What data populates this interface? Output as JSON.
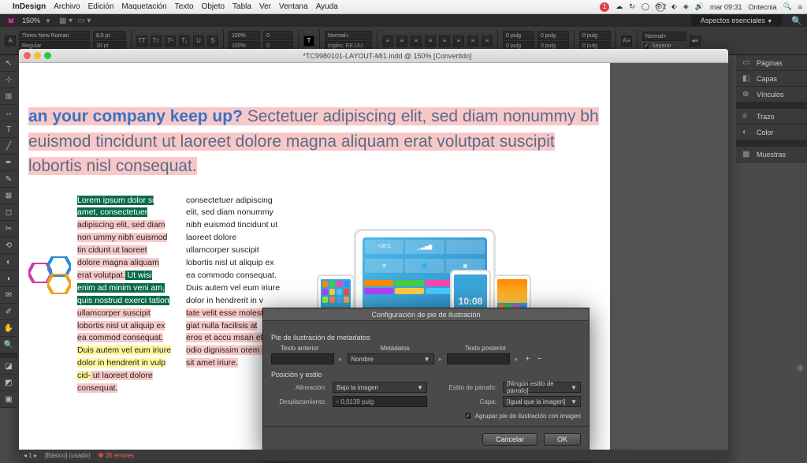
{
  "menubar": {
    "app_name": "InDesign",
    "items": [
      "Archivo",
      "Edición",
      "Maquetación",
      "Texto",
      "Objeto",
      "Tabla",
      "Ver",
      "Ventana",
      "Ayuda"
    ],
    "status": {
      "badge1": "1",
      "badge2": "2",
      "time": "mar 09:31",
      "user": "Ontecnia"
    }
  },
  "app": {
    "zoom": "150%",
    "workspace": "Aspectos esenciales"
  },
  "control": {
    "font_family": "Times New Roman",
    "font_style": "Regular",
    "font_size": "8,5 pt",
    "leading": "10 pt",
    "kerning": "0",
    "tracking": "100%",
    "baseline": "100%",
    "para_style": "Normal+",
    "lang": "Inglés: EE.UU.",
    "indent": "0 pulg",
    "char_style": "Normal+",
    "hyphen": "Separar"
  },
  "document": {
    "title": "*TC9980101-LAYOUT-MI1.indd @ 150% [Convertido]",
    "headline_q": "an your company keep up?",
    "headline_rest": " Sectetuer adipiscing elit, sed diam nonummy bh euismod tincidunt ut laoreet dolore magna aliquam erat volutpat suscipit lobortis nisl consequat.",
    "col1": {
      "g1": "Lorem ipsum dolor si amet, consectetuer",
      "p1": " adipiscing elit, sed diam non ummy nibh euismod tin cidunt ut laoreet dolore magna aliquam erat volutpat.",
      "g2": " Ut wisi enim ad minim veni am, quis nostrud exerci tation",
      "p2": " ullamcorper suscipit lobortis nisl ut aliquip ex ea commod consequat.",
      "y1": "Duis autem vel eum iriure dolor in hendrerit in vulp cid-",
      "p3": " ut laoreet dolore consequat."
    },
    "col2": {
      "t1": "consectetuer adipiscing elit, sed diam nonummy nibh euismod tincidunt ut laoreet dolore ullamcorper suscipit lobortis nisl ut aliquip ex ea commodo consequat.",
      "t2": "Duis autem vel eum iriure dolor in hendrerit in v",
      "p1": "tate velit esse molesti",
      "p2": "giat nulla facilisis at",
      "p3": "eros et accu msan et j",
      "p4": "odio dignissim orem ip",
      "p5": "sit amet iriure."
    },
    "clock": "10:08",
    "temp": "+28°C"
  },
  "dialog": {
    "title": "Configuración de pie de ilustración",
    "section1": "Pie de ilustración de metadatos",
    "lbl_before": "Texto anterior",
    "lbl_meta": "Metadatos",
    "lbl_after": "Texto posterior",
    "meta_value": "Nombre",
    "section2": "Posición y estilo",
    "lbl_align": "Alineación:",
    "align_value": "Bajo la imagen",
    "lbl_parastyle": "Estilo de párrafo:",
    "parastyle_value": "[Ningún estilo de párrafo]",
    "lbl_offset": "Desplazamiento:",
    "offset_value": "0,0139 pulg",
    "lbl_layer": "Capa:",
    "layer_value": "[Igual que la imagen]",
    "checkbox": "Agrupar pie de ilustración con imagen",
    "btn_cancel": "Cancelar",
    "btn_ok": "OK"
  },
  "status": {
    "style": "[Básico] (usado)",
    "errors": "35 errores"
  },
  "tools": [
    "↖",
    "⊹",
    "T",
    "╱",
    "◻",
    "✎",
    "✂",
    "◐",
    "▭",
    "⬚",
    "✥",
    "◫",
    "⊡",
    "◧",
    "Q",
    "⊕",
    "⬒",
    "⬓"
  ],
  "panels": [
    "Páginas",
    "Capas",
    "Vínculos"
  ],
  "panels2": [
    "Trazo",
    "Color"
  ],
  "panels3": [
    "Muestras"
  ],
  "panel_icons": [
    "▭",
    "◧",
    "⊗",
    "≡",
    "◐",
    "▦"
  ]
}
